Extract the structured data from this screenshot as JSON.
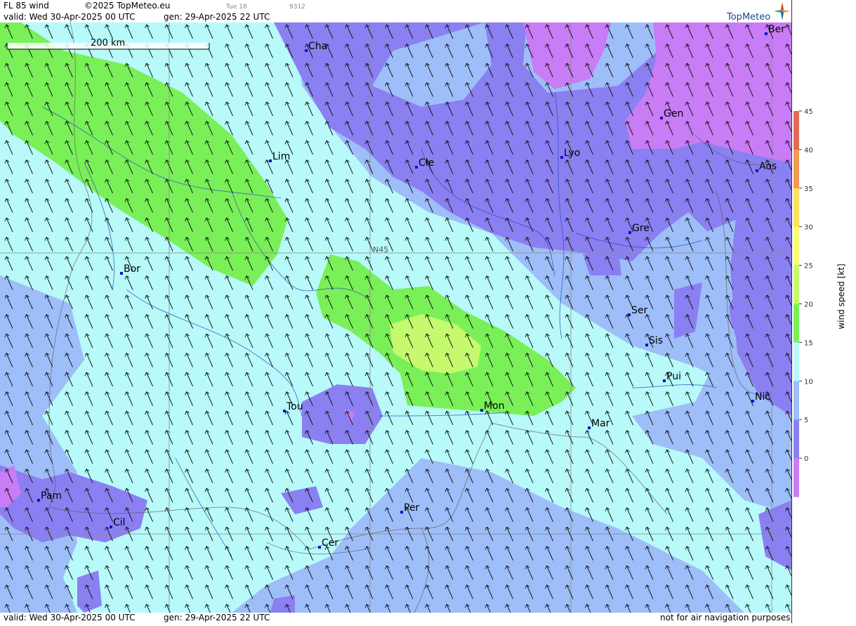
{
  "header": {
    "level": "FL 85 wind",
    "copyright": "©2025 TopMeteo.eu",
    "day": "Tue 18",
    "code": "9312",
    "valid": "valid:  Wed  30-Apr-2025  00 UTC",
    "gen": "gen: 29-Apr-2025 22 UTC",
    "logo": "TopMeteo"
  },
  "footer": {
    "valid": "valid:  Wed  30-Apr-2025  00 UTC",
    "gen": "gen: 29-Apr-2025 22 UTC",
    "disclaimer": "not for air navigation purposes"
  },
  "map": {
    "scale_label": "200 km",
    "lat_label": "N45",
    "cities": [
      {
        "name": "Cha"
      },
      {
        "name": "Ber"
      },
      {
        "name": "Gen"
      },
      {
        "name": "Lim"
      },
      {
        "name": "Cle"
      },
      {
        "name": "Lyo"
      },
      {
        "name": "Aos"
      },
      {
        "name": "Gre"
      },
      {
        "name": "Bor"
      },
      {
        "name": "Ser"
      },
      {
        "name": "Sis"
      },
      {
        "name": "Pui"
      },
      {
        "name": "Tou"
      },
      {
        "name": "Mon"
      },
      {
        "name": "Mar"
      },
      {
        "name": "Nic"
      },
      {
        "name": "Pam"
      },
      {
        "name": "Cil"
      },
      {
        "name": "Per"
      },
      {
        "name": "Cer"
      }
    ]
  },
  "legend": {
    "title": "wind speed [kt]",
    "ticks": [
      "45",
      "40",
      "35",
      "30",
      "25",
      "20",
      "15",
      "10",
      "5",
      "0"
    ],
    "colors": [
      "#e06a55",
      "#f39a55",
      "#fde060",
      "#f8fc78",
      "#c6fa6e",
      "#7af058",
      "#b8fafa",
      "#9ebef9",
      "#8a80f2",
      "#c87cf5"
    ]
  },
  "colors": {
    "wind_0_5": "#c87cf5",
    "wind_5_10": "#8a80f2",
    "wind_10_15": "#9ebef9",
    "wind_15_20": "#b8fafa",
    "wind_20_25": "#7af058",
    "wind_25_30": "#c6fa6e"
  }
}
